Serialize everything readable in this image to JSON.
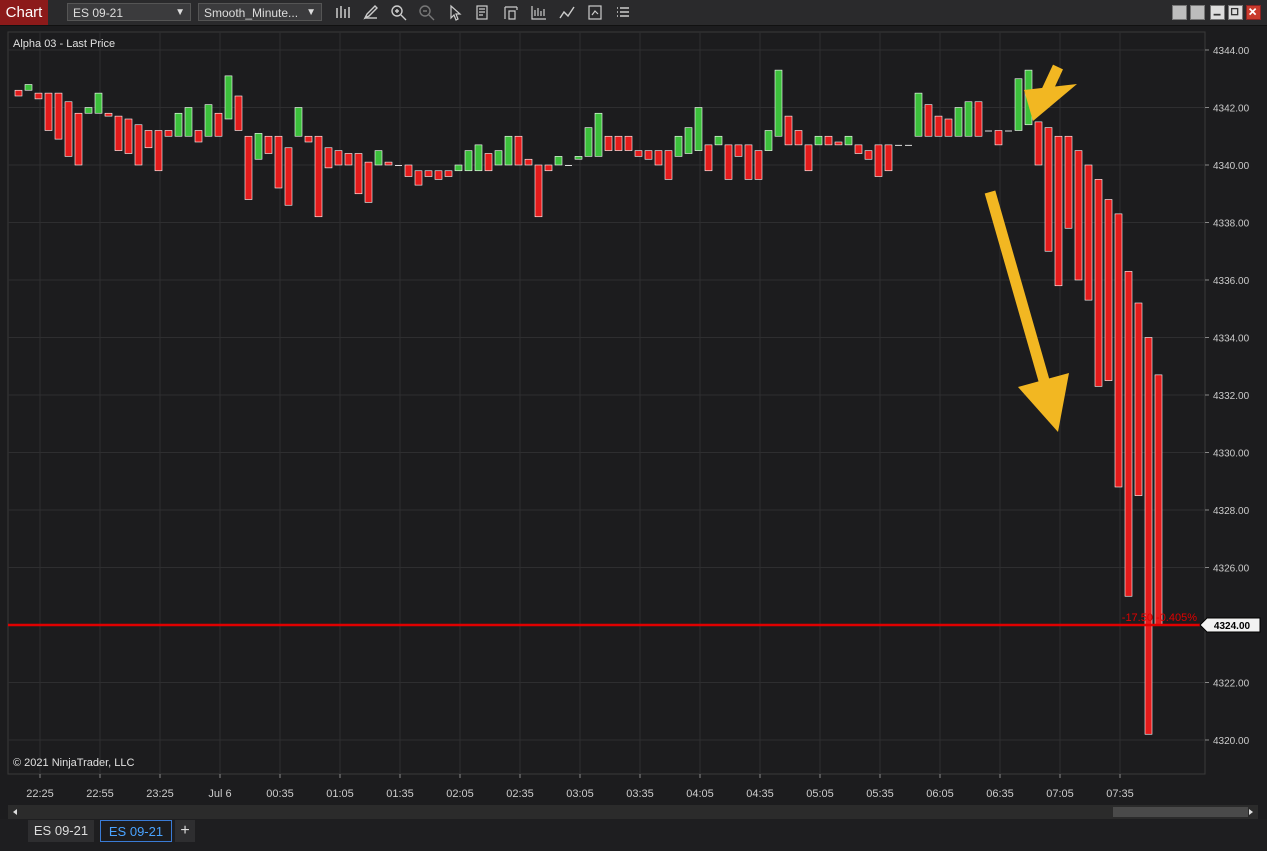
{
  "app_title": "Chart",
  "toolbar": {
    "instrument": "ES 09-21",
    "bar_type": "Smooth_Minute...",
    "icons": [
      "bar-chart-icon",
      "pencil-icon",
      "zoom-in-icon",
      "zoom-out-icon",
      "pointer-icon",
      "data-box-icon",
      "properties-icon",
      "indicators-icon",
      "strategies-icon",
      "templates-icon",
      "list-icon"
    ]
  },
  "chart": {
    "label": "Alpha 03 - Last Price",
    "copyright": "© 2021 NinjaTrader, LLC",
    "price_marker": "4324.00",
    "change_label": "-17.50 -0.405%"
  },
  "colors": {
    "up": "#3bbf3b",
    "down": "#e31b1b",
    "price_line": "#e00000",
    "annotation": "#f2b722",
    "background": "#1c1c1e"
  },
  "chart_data": {
    "type": "bar",
    "y_ticks": [
      "4344.00",
      "4342.00",
      "4340.00",
      "4338.00",
      "4336.00",
      "4334.00",
      "4332.00",
      "4330.00",
      "4328.00",
      "4326.00",
      "4324.00",
      "4322.00",
      "4320.00"
    ],
    "x_ticks": [
      "22:25",
      "22:55",
      "23:25",
      "Jul 6",
      "00:35",
      "01:05",
      "01:35",
      "02:05",
      "02:35",
      "03:05",
      "03:35",
      "04:05",
      "04:35",
      "05:05",
      "05:35",
      "06:05",
      "06:35",
      "07:05",
      "07:35"
    ],
    "ylim": [
      4319.5,
      4344.5
    ],
    "last_price": 4324.0,
    "bars": [
      [
        4342.4,
        4342.6
      ],
      [
        4342.6,
        4342.8
      ],
      [
        4342.3,
        4342.5
      ],
      [
        4341.2,
        4342.5
      ],
      [
        4340.9,
        4342.5
      ],
      [
        4340.3,
        4342.2
      ],
      [
        4340.0,
        4341.8
      ],
      [
        4341.8,
        4342.0
      ],
      [
        4341.8,
        4342.5
      ],
      [
        4341.7,
        4341.8
      ],
      [
        4340.5,
        4341.7
      ],
      [
        4340.4,
        4341.6
      ],
      [
        4340.0,
        4341.4
      ],
      [
        4340.6,
        4341.2
      ],
      [
        4339.8,
        4341.2
      ],
      [
        4341.0,
        4341.2
      ],
      [
        4341.0,
        4341.8
      ],
      [
        4341.0,
        4342.0
      ],
      [
        4340.8,
        4341.2
      ],
      [
        4341.0,
        4342.1
      ],
      [
        4341.0,
        4341.8
      ],
      [
        4341.6,
        4343.1
      ],
      [
        4341.2,
        4342.4
      ],
      [
        4338.8,
        4341.0
      ],
      [
        4340.2,
        4341.1
      ],
      [
        4340.4,
        4341.0
      ],
      [
        4339.2,
        4341.0
      ],
      [
        4338.6,
        4340.6
      ],
      [
        4341.0,
        4342.0
      ],
      [
        4340.8,
        4341.0
      ],
      [
        4338.2,
        4341.0
      ],
      [
        4339.9,
        4340.6
      ],
      [
        4340.0,
        4340.5
      ],
      [
        4340.0,
        4340.4
      ],
      [
        4339.0,
        4340.4
      ],
      [
        4338.7,
        4340.1
      ],
      [
        4340.0,
        4340.5
      ],
      [
        4340.0,
        4340.1
      ],
      [
        4340.0,
        4340.0
      ],
      [
        4339.6,
        4340.0
      ],
      [
        4339.3,
        4339.8
      ],
      [
        4339.6,
        4339.8
      ],
      [
        4339.5,
        4339.8
      ],
      [
        4339.6,
        4339.8
      ],
      [
        4339.8,
        4340.0
      ],
      [
        4339.8,
        4340.5
      ],
      [
        4339.8,
        4340.7
      ],
      [
        4339.8,
        4340.4
      ],
      [
        4340.0,
        4340.5
      ],
      [
        4340.0,
        4341.0
      ],
      [
        4340.0,
        4341.0
      ],
      [
        4340.0,
        4340.2
      ],
      [
        4338.2,
        4340.0
      ],
      [
        4339.8,
        4340.0
      ],
      [
        4340.0,
        4340.3
      ],
      [
        4340.0,
        4340.0
      ],
      [
        4340.2,
        4340.3
      ],
      [
        4340.3,
        4341.3
      ],
      [
        4340.3,
        4341.8
      ],
      [
        4340.5,
        4341.0
      ],
      [
        4340.5,
        4341.0
      ],
      [
        4340.5,
        4341.0
      ],
      [
        4340.3,
        4340.5
      ],
      [
        4340.2,
        4340.5
      ],
      [
        4340.0,
        4340.5
      ],
      [
        4339.5,
        4340.5
      ],
      [
        4340.3,
        4341.0
      ],
      [
        4340.4,
        4341.3
      ],
      [
        4340.5,
        4342.0
      ],
      [
        4339.8,
        4340.7
      ],
      [
        4340.7,
        4341.0
      ],
      [
        4339.5,
        4340.7
      ],
      [
        4340.3,
        4340.7
      ],
      [
        4339.5,
        4340.7
      ],
      [
        4339.5,
        4340.5
      ],
      [
        4340.5,
        4341.2
      ],
      [
        4341.0,
        4343.3
      ],
      [
        4340.7,
        4341.7
      ],
      [
        4340.7,
        4341.2
      ],
      [
        4339.8,
        4340.7
      ],
      [
        4340.7,
        4341.0
      ],
      [
        4340.7,
        4341.0
      ],
      [
        4340.7,
        4340.8
      ],
      [
        4340.7,
        4341.0
      ],
      [
        4340.4,
        4340.7
      ],
      [
        4340.2,
        4340.5
      ],
      [
        4339.6,
        4340.7
      ],
      [
        4339.8,
        4340.7
      ],
      [
        4340.7,
        4340.7
      ],
      [
        4340.7,
        4340.7
      ],
      [
        4341.0,
        4342.5
      ],
      [
        4341.0,
        4342.1
      ],
      [
        4341.0,
        4341.7
      ],
      [
        4341.0,
        4341.6
      ],
      [
        4341.0,
        4342.0
      ],
      [
        4341.0,
        4342.2
      ],
      [
        4341.0,
        4342.2
      ],
      [
        4341.2,
        4341.2
      ],
      [
        4340.7,
        4341.2
      ],
      [
        4341.2,
        4341.2
      ],
      [
        4341.2,
        4343.0
      ],
      [
        4341.4,
        4343.3
      ],
      [
        4340.0,
        4341.5
      ],
      [
        4337.0,
        4341.3
      ],
      [
        4335.8,
        4341.0
      ],
      [
        4337.8,
        4341.0
      ],
      [
        4336.0,
        4340.5
      ],
      [
        4335.3,
        4340.0
      ],
      [
        4332.3,
        4339.5
      ],
      [
        4332.5,
        4338.8
      ],
      [
        4328.8,
        4338.3
      ],
      [
        4325.0,
        4336.3
      ],
      [
        4328.5,
        4335.2
      ],
      [
        4320.2,
        4334.0
      ],
      [
        4324.0,
        4332.7
      ]
    ]
  }
}
